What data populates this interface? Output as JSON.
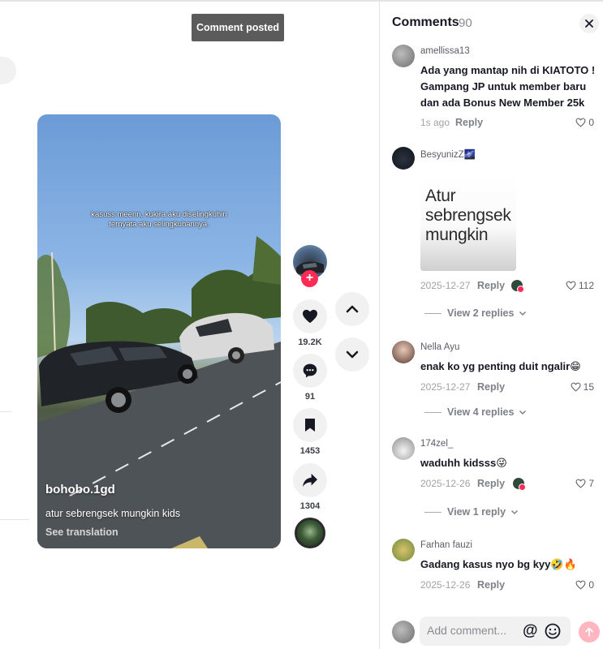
{
  "toast": {
    "text": "Comment posted"
  },
  "video": {
    "caption_line1": "kasuss meenn, kukira aku diselingkuhin",
    "caption_line2": "ternyata aku selingkuhannya.",
    "author": "bohobo.1gd",
    "description": "atur sebrengsek mungkin kids",
    "translate": "See translation"
  },
  "actions": {
    "likes": "19.2K",
    "comments": "91",
    "saves": "1453",
    "shares": "1304"
  },
  "icons": {
    "like": "heart-icon",
    "comment": "comment-bubble-icon",
    "save": "bookmark-icon",
    "share": "share-arrow-icon",
    "up": "chevron-up-icon",
    "down": "chevron-down-icon",
    "close": "close-icon"
  },
  "colors": {
    "accent": "#fe2c55",
    "send_disabled": "#ffb6c1"
  },
  "comments_panel": {
    "title": "Comments",
    "count": "90",
    "input_placeholder": "Add comment...",
    "at_symbol": "@",
    "items": [
      {
        "user": "amellissa13",
        "text": "Ada yang mantap nih di KIATOTO ! Gampang JP untuk member baru dan ada Bonus New Member 25k",
        "date": "1s ago",
        "reply": "Reply",
        "likes": "0"
      },
      {
        "user": "BesyunizZ🌌",
        "sticker_lines": [
          "Atur",
          "sebrengsek",
          "mungkin"
        ],
        "date": "2025-12-27",
        "reply": "Reply",
        "likes": "112",
        "view_replies": "View 2 replies"
      },
      {
        "user": "Nella Ayu",
        "text": "enak ko yg penting duit ngalir😁",
        "date": "2025-12-27",
        "reply": "Reply",
        "likes": "15",
        "view_replies": "View 4 replies"
      },
      {
        "user": "174zel_",
        "text": "waduhh kidsss😜",
        "date": "2025-12-26",
        "reply": "Reply",
        "likes": "7",
        "view_replies": "View 1 reply"
      },
      {
        "user": "Farhan fauzi",
        "text": "Gadang kasus nyo bg kyy🤣🔥",
        "date": "2025-12-26",
        "reply": "Reply",
        "likes": "0"
      }
    ]
  }
}
